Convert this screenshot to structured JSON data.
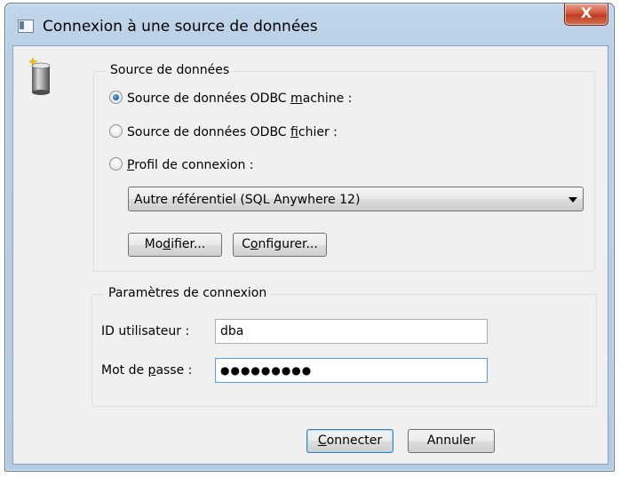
{
  "window": {
    "title": "Connexion à une source de données",
    "close_label": "X"
  },
  "data_source": {
    "group_title": "Source de données",
    "options": [
      {
        "pre": "Source de données ODBC ",
        "mnemonic": "m",
        "post": "achine :",
        "checked": true
      },
      {
        "pre": "Source de données ODBC ",
        "mnemonic": "f",
        "post": "ichier :",
        "checked": false
      },
      {
        "pre": "",
        "mnemonic": "P",
        "post": "rofil de connexion :",
        "checked": false
      }
    ],
    "dropdown_value": "Autre référentiel (SQL Anywhere 12)",
    "modify_button": {
      "pre": "Mo",
      "mnemonic": "d",
      "post": "ifier..."
    },
    "configure_button": {
      "pre": "C",
      "mnemonic": "o",
      "post": "nfigurer..."
    }
  },
  "connection": {
    "group_title": "Paramètres de connexion",
    "user_label": "ID utilisateur :",
    "user_value": "dba",
    "password_label_pre": "Mot de ",
    "password_label_mnemonic": "p",
    "password_label_post": "asse :",
    "password_value": "●●●●●●●●●"
  },
  "footer": {
    "connect_button": {
      "mnemonic": "C",
      "post": "onnecter"
    },
    "cancel_label": "Annuler"
  }
}
